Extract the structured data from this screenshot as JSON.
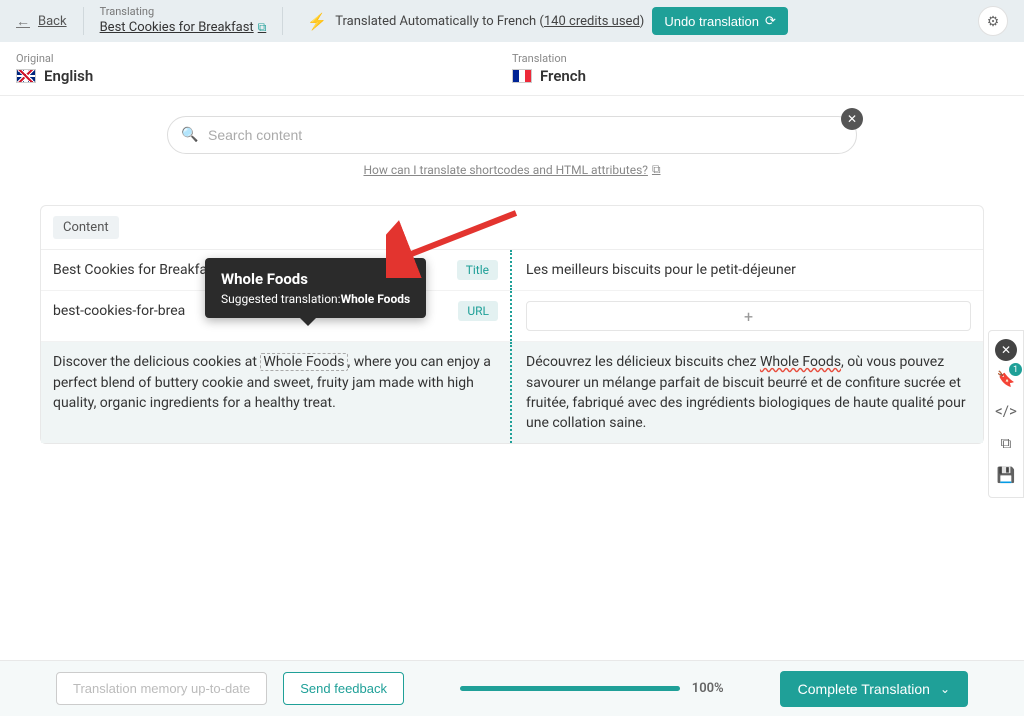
{
  "header": {
    "back": "Back",
    "translating_label": "Translating",
    "translating_title": "Best Cookies for Breakfast",
    "auto_prefix": "Translated Automatically to French (",
    "credits": "140 credits used",
    "auto_suffix": ")",
    "undo_label": "Undo translation"
  },
  "langs": {
    "original_label": "Original",
    "original_name": "English",
    "translation_label": "Translation",
    "translation_name": "French"
  },
  "search": {
    "placeholder": "Search content",
    "help_link": "How can I translate shortcodes and HTML attributes?"
  },
  "content": {
    "tag": "Content",
    "rows": [
      {
        "left": "Best Cookies for Breakfast",
        "tag": "Title",
        "right": "Les meilleurs biscuits pour le petit-déjeuner"
      },
      {
        "left": "best-cookies-for-brea",
        "tag": "URL",
        "right": ""
      }
    ],
    "desc_row": {
      "left_pre": "Discover the delicious cookies at ",
      "left_term": "Whole Foods",
      "left_post": ", where you can enjoy a perfect blend of buttery cookie and sweet, fruity jam made with high quality, organic ingredients for a healthy treat.",
      "right_pre": "Découvrez les délicieux biscuits chez ",
      "right_term": "Whole Foods",
      "right_post": ", où vous pouvez savourer un mélange parfait de biscuit beurré et de confiture sucrée et fruitée, fabriqué avec des ingrédients biologiques de haute qualité pour une collation saine."
    }
  },
  "tooltip": {
    "title": "Whole Foods",
    "sub_label": "Suggested translation:",
    "sub_value": "Whole Foods"
  },
  "sidebar": {
    "badge": "1"
  },
  "footer": {
    "memory_btn": "Translation memory up-to-date",
    "feedback_btn": "Send feedback",
    "progress": "100%",
    "complete_btn": "Complete Translation"
  }
}
